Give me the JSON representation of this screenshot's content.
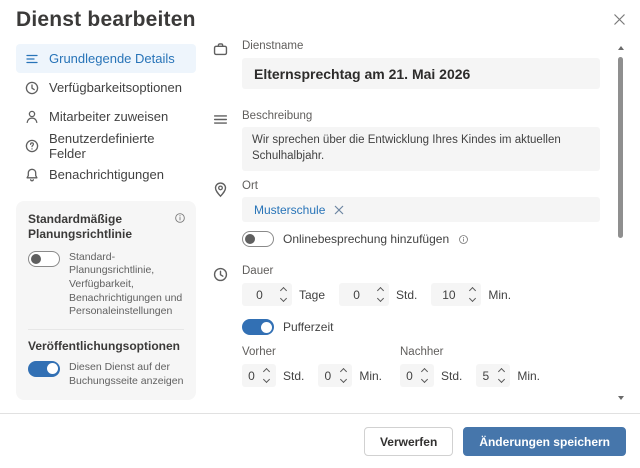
{
  "dialog": {
    "title": "Dienst bearbeiten"
  },
  "sidebar": {
    "items": [
      {
        "label": "Grundlegende Details",
        "icon": "form-lines-icon",
        "selected": true
      },
      {
        "label": "Verfügbarkeitsoptionen",
        "icon": "clock-icon",
        "selected": false
      },
      {
        "label": "Mitarbeiter zuweisen",
        "icon": "person-icon",
        "selected": false
      },
      {
        "label": "Benutzerdefinierte Felder",
        "icon": "question-circle-icon",
        "selected": false
      },
      {
        "label": "Benachrichtigungen",
        "icon": "bell-icon",
        "selected": false
      }
    ],
    "policy_card": {
      "title": "Standardmäßige Planungsrichtlinie",
      "default_toggle": {
        "on": false,
        "label": "Standard-Planungsrichtlinie, Verfügbarkeit, Benachrichtigungen und Personaleinstellungen"
      },
      "publish_title": "Veröffentlichungsoptionen",
      "publish_toggle": {
        "on": true,
        "label": "Diesen Dienst auf der Buchungsseite anzeigen"
      }
    }
  },
  "form": {
    "service_name": {
      "label": "Dienstname",
      "value": "Elternsprechtag am 21. Mai 2026"
    },
    "description": {
      "label": "Beschreibung",
      "value": "Wir sprechen über die Entwicklung Ihres Kindes im aktuellen Schulhalbjahr."
    },
    "location": {
      "label": "Ort",
      "chip": "Musterschule",
      "online_meeting_toggle": {
        "on": false,
        "label": "Onlinebesprechung hinzufügen"
      }
    },
    "duration": {
      "label": "Dauer",
      "days": {
        "value": "0",
        "unit": "Tage"
      },
      "hours": {
        "value": "0",
        "unit": "Std."
      },
      "minutes": {
        "value": "10",
        "unit": "Min."
      }
    },
    "buffer": {
      "toggle": {
        "on": true,
        "label": "Pufferzeit"
      },
      "before": {
        "label": "Vorher",
        "hours": {
          "value": "0",
          "unit": "Std."
        },
        "minutes": {
          "value": "0",
          "unit": "Min."
        }
      },
      "after": {
        "label": "Nachher",
        "hours": {
          "value": "0",
          "unit": "Std."
        },
        "minutes": {
          "value": "5",
          "unit": "Min."
        }
      }
    }
  },
  "footer": {
    "discard_label": "Verwerfen",
    "save_label": "Änderungen speichern"
  },
  "colors": {
    "accent_blue": "#2874b8",
    "toggle_on_blue": "#3270b4",
    "primary_button_blue": "#4676ab",
    "field_background": "#f5f5f5",
    "card_background": "#f6f6f6",
    "selected_nav_background": "#eef5fc",
    "label_gray": "#605e5c",
    "title_gray": "#3b3a39"
  }
}
